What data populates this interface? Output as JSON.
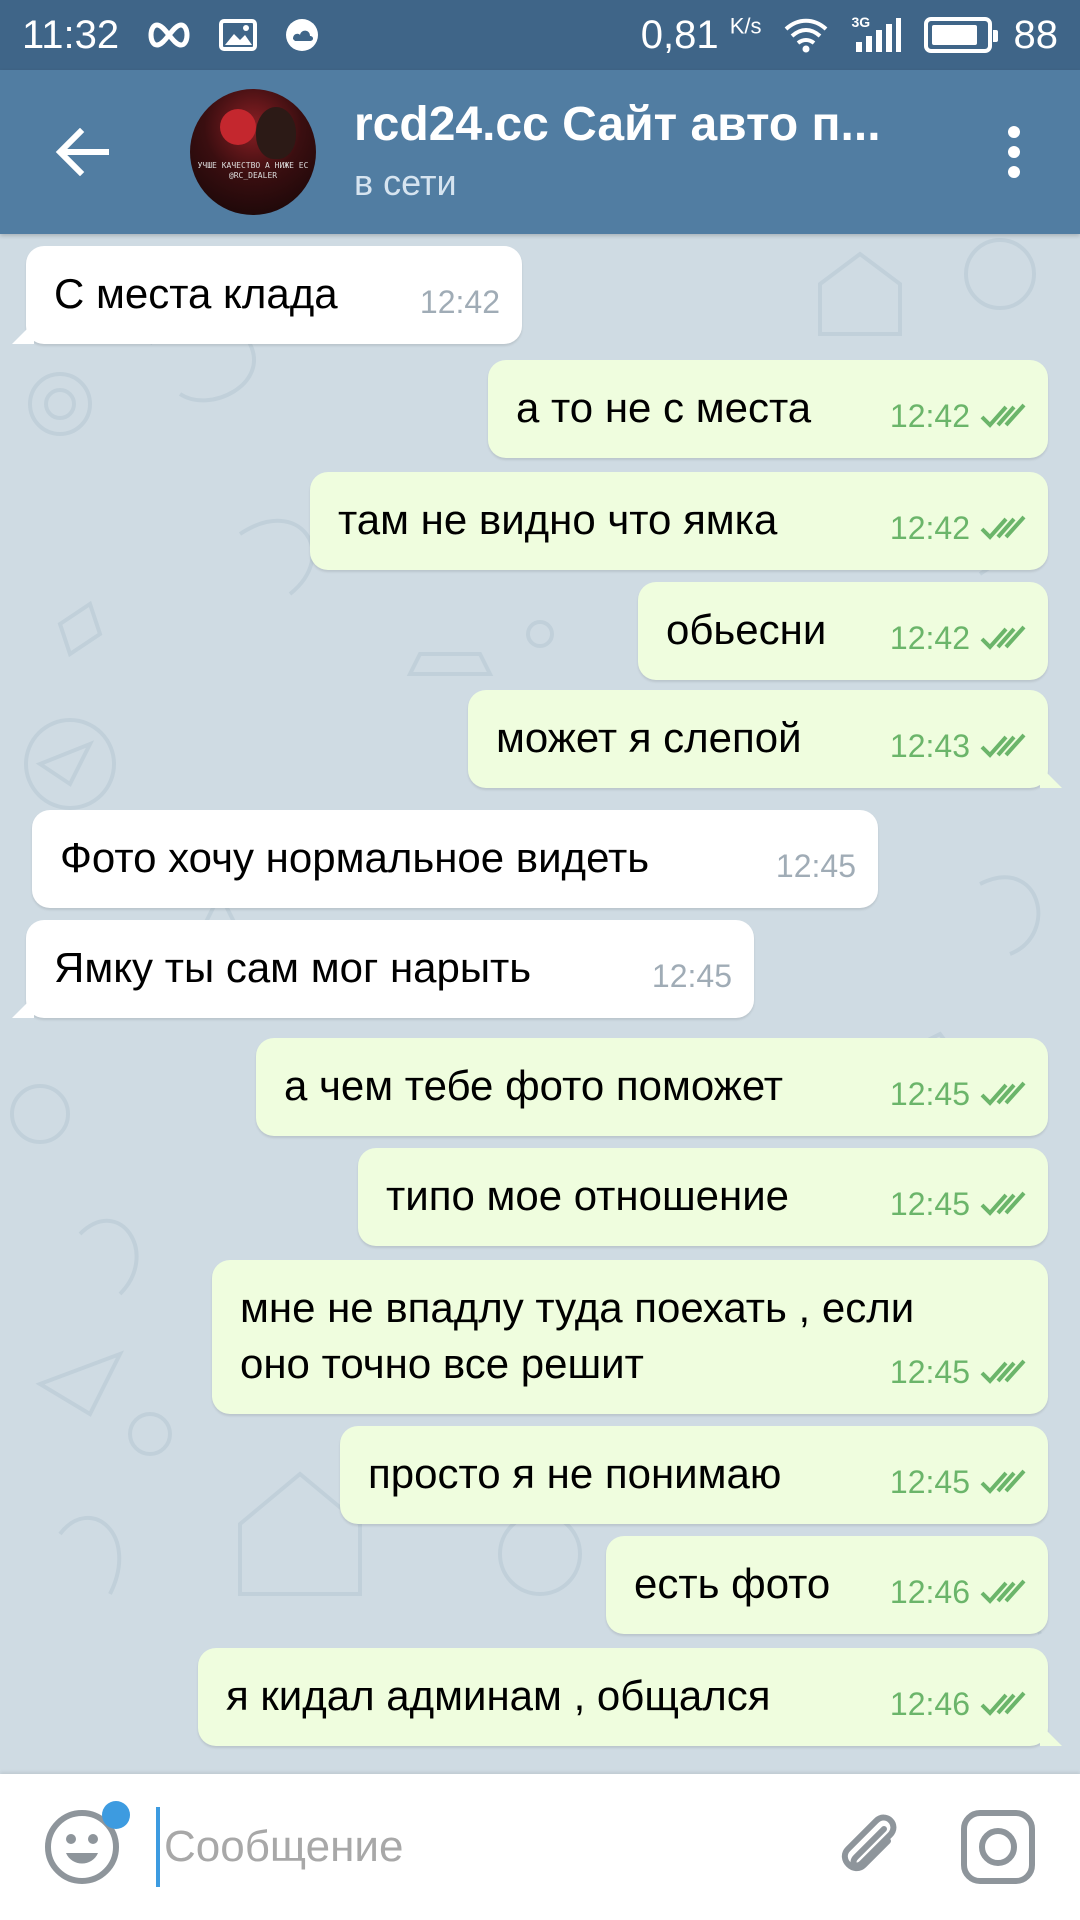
{
  "status_bar": {
    "time": "11:32",
    "net_speed": "0,81",
    "net_unit": "K/s",
    "network_type": "3G",
    "battery": "88",
    "battery_level": 0.88,
    "icons": [
      "infinity-icon",
      "image-icon",
      "cloud-icon",
      "wifi-icon",
      "signal-icon",
      "battery-icon"
    ]
  },
  "header": {
    "title": "rcd24.cc Сайт авто п...",
    "status": "в сети",
    "avatar_lines": [
      "УЧШЕ КАЧЕСТВО А НИЖЕ ЕС",
      "@RC_DEALER"
    ]
  },
  "messages": [
    {
      "dir": "in",
      "text": "С места клада",
      "time": "12:42"
    },
    {
      "dir": "out",
      "text": "а то не с места",
      "time": "12:42"
    },
    {
      "dir": "out",
      "text": "там не видно что ямка",
      "time": "12:42"
    },
    {
      "dir": "out",
      "text": "обьесни",
      "time": "12:42"
    },
    {
      "dir": "out",
      "text": "может я слепой",
      "time": "12:43"
    },
    {
      "dir": "in",
      "text": "Фото хочу нормальное видеть",
      "time": "12:45"
    },
    {
      "dir": "in",
      "text": "Ямку ты сам мог нарыть",
      "time": "12:45"
    },
    {
      "dir": "out",
      "text": "а чем тебе фото поможет",
      "time": "12:45"
    },
    {
      "dir": "out",
      "text": "типо мое отношение",
      "time": "12:45"
    },
    {
      "dir": "out",
      "text": "мне не впадлу туда поехать , если\nоно точно все решит",
      "time": "12:45"
    },
    {
      "dir": "out",
      "text": "просто я не понимаю",
      "time": "12:45"
    },
    {
      "dir": "out",
      "text": "есть фото",
      "time": "12:46"
    },
    {
      "dir": "out",
      "text": "я кидал админам , общался",
      "time": "12:46"
    }
  ],
  "input": {
    "placeholder": "Сообщение",
    "value": ""
  },
  "colors": {
    "status_bar": "#3f6588",
    "header": "#517da2",
    "bubble_in": "#ffffff",
    "bubble_out": "#effdde",
    "time_out": "#6bb56a",
    "accent": "#3d9be0"
  }
}
